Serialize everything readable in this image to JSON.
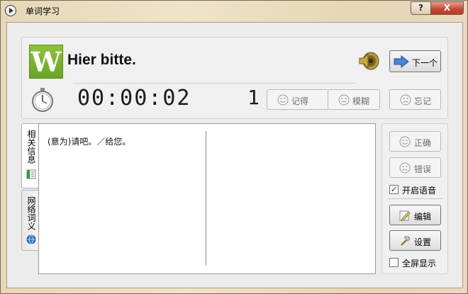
{
  "window": {
    "title": "单词学习",
    "help_button": "?",
    "close_button": "X"
  },
  "word": {
    "logo_letter": "W",
    "phrase": "Hier bitte.",
    "next_label": "下一个",
    "timer": "00:00:02",
    "count": "1"
  },
  "rating": {
    "remember_label": "记得",
    "vague_label": "模糊",
    "forget_label": "忘记"
  },
  "tabs": {
    "info": "相关信息",
    "web": "网络词义"
  },
  "content": {
    "meaning": "(意为)请吧。／给您。"
  },
  "side": {
    "correct_label": "正确",
    "wrong_label": "错误",
    "voice_label": "开启语音",
    "voice_checked": true,
    "edit_label": "编辑",
    "settings_label": "设置",
    "fullscreen_label": "全屏显示",
    "fullscreen_checked": false
  }
}
